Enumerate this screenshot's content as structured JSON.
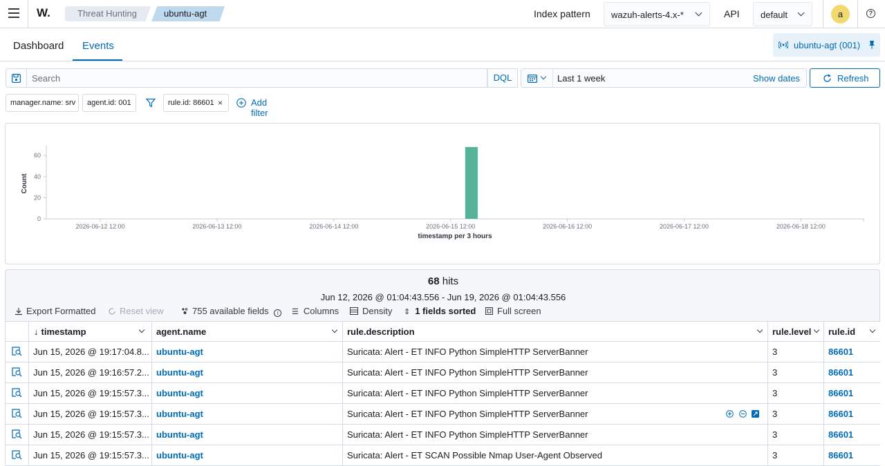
{
  "topbar": {
    "logo": "W.",
    "breadcrumbs": [
      "Threat Hunting",
      "ubuntu-agt"
    ],
    "index_pattern_label": "Index pattern",
    "index_pattern_value": "wazuh-alerts-4.x-*",
    "api_label": "API",
    "api_value": "default",
    "avatar_initial": "a"
  },
  "tabs": [
    {
      "label": "Dashboard",
      "active": false
    },
    {
      "label": "Events",
      "active": true
    }
  ],
  "agent_pill": "ubuntu-agt (001)",
  "search": {
    "placeholder": "Search",
    "language": "DQL",
    "date_range": "Last 1 week",
    "show_dates": "Show dates",
    "refresh": "Refresh"
  },
  "filters": {
    "pills": [
      "manager.name: srv",
      "agent.id: 001",
      "rule.id: 86601"
    ],
    "add_filter": "Add filter"
  },
  "chart_data": {
    "type": "bar",
    "x": [
      "2026-06-15 15:00"
    ],
    "values": [
      68
    ],
    "ylabel": "Count",
    "xlabel": "timestamp per 3 hours",
    "ylim": [
      0,
      68
    ],
    "yticks": [
      0,
      20,
      40,
      60
    ],
    "xticks": [
      "2026-06-12 12:00",
      "2026-06-13 12:00",
      "2026-06-14 12:00",
      "2026-06-15 12:00",
      "2026-06-16 12:00",
      "2026-06-17 12:00",
      "2026-06-18 12:00"
    ],
    "color": "#54b399",
    "grid": false
  },
  "results": {
    "hits_count": "68",
    "hits_label": "hits",
    "range": "Jun 12, 2026 @ 01:04:43.556 - Jun 19, 2026 @ 01:04:43.556",
    "toolbar": {
      "export": "Export Formatted",
      "reset": "Reset view",
      "fields": "755 available fields",
      "columns": "Columns",
      "density": "Density",
      "sorted": "1 fields sorted",
      "fullscreen": "Full screen"
    },
    "columns": [
      "timestamp",
      "agent.name",
      "rule.description",
      "rule.level",
      "rule.id"
    ],
    "rows": [
      {
        "timestamp": "Jun 15, 2026 @ 19:17:04.8...",
        "agent": "ubuntu-agt",
        "description": "Suricata: Alert - ET INFO Python SimpleHTTP ServerBanner",
        "level": "3",
        "id": "86601"
      },
      {
        "timestamp": "Jun 15, 2026 @ 19:16:57.2...",
        "agent": "ubuntu-agt",
        "description": "Suricata: Alert - ET INFO Python SimpleHTTP ServerBanner",
        "level": "3",
        "id": "86601"
      },
      {
        "timestamp": "Jun 15, 2026 @ 19:15:57.3...",
        "agent": "ubuntu-agt",
        "description": "Suricata: Alert - ET INFO Python SimpleHTTP ServerBanner",
        "level": "3",
        "id": "86601"
      },
      {
        "timestamp": "Jun 15, 2026 @ 19:15:57.3...",
        "agent": "ubuntu-agt",
        "description": "Suricata: Alert - ET INFO Python SimpleHTTP ServerBanner",
        "level": "3",
        "id": "86601"
      },
      {
        "timestamp": "Jun 15, 2026 @ 19:15:57.3...",
        "agent": "ubuntu-agt",
        "description": "Suricata: Alert - ET INFO Python SimpleHTTP ServerBanner",
        "level": "3",
        "id": "86601"
      },
      {
        "timestamp": "Jun 15, 2026 @ 19:15:57.3...",
        "agent": "ubuntu-agt",
        "description": "Suricata: Alert - ET SCAN Possible Nmap User-Agent Observed",
        "level": "3",
        "id": "86601"
      }
    ]
  }
}
